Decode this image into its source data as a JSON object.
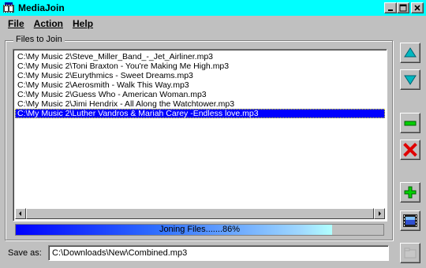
{
  "window": {
    "title": "MediaJoin",
    "icon": "filmstrip-app-icon",
    "controls": [
      "minimize-icon",
      "maximize-icon",
      "close-icon"
    ]
  },
  "menu": [
    {
      "label": "File"
    },
    {
      "label": "Action"
    },
    {
      "label": "Help"
    }
  ],
  "files_group": {
    "label": "Files to Join",
    "files": [
      "C:\\My Music 2\\Steve_Miller_Band_-_Jet_Airliner.mp3",
      "C:\\My Music 2\\Toni Braxton - You're Making Me High.mp3",
      "C:\\My Music 2\\Eurythmics - Sweet Dreams.mp3",
      "C:\\My Music 2\\Aerosmith - Walk This Way.mp3",
      "C:\\My Music 2\\Guess Who - American Woman.mp3",
      "C:\\My Music 2\\Jimi Hendrix - All Along the Watchtower.mp3",
      "C:\\My Music 2\\Luther Vandros & Mariah Carey -Endless love.mp3"
    ],
    "selected_index": 6
  },
  "progress": {
    "text": "Joning Files.......86%",
    "fraction": 0.86
  },
  "save": {
    "label": "Save as:",
    "value": "C:\\Downloads\\New\\Combined.mp3"
  },
  "tools": [
    {
      "name": "move-up-button",
      "icon": "arrow-up-icon",
      "color": "#00a8a8"
    },
    {
      "name": "move-down-button",
      "icon": "arrow-down-icon",
      "color": "#00a8a8"
    },
    {
      "name": "remove-button",
      "icon": "minus-icon",
      "color": "#00c000"
    },
    {
      "name": "delete-button",
      "icon": "x-icon",
      "color": "#e00000"
    },
    {
      "name": "add-button",
      "icon": "plus-icon",
      "color": "#00c000"
    },
    {
      "name": "join-button",
      "icon": "filmstrip-icon",
      "color": "#000080"
    },
    {
      "name": "browse-button",
      "icon": "folder-icon",
      "color": "#808080"
    }
  ],
  "colors": {
    "titlebar": "#00ffff",
    "selection": "#0000ff",
    "face": "#c0c0c0"
  }
}
